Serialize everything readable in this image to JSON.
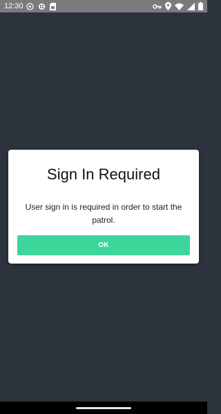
{
  "status_bar": {
    "time": "12:30",
    "left_icons": [
      "settings-notification-icon",
      "gear-icon",
      "sim-card-icon"
    ],
    "right_icons": [
      "vpn-key-icon",
      "location-icon",
      "wifi-icon",
      "signal-icon",
      "battery-icon"
    ]
  },
  "dialog": {
    "title": "Sign In Required",
    "message": "User sign in is required in order to start the patrol.",
    "ok_label": "OK"
  },
  "colors": {
    "background": "#2d333d",
    "status_bar": "#7b7b7b",
    "dialog": "#ffffff",
    "accent": "#3dd69b",
    "nav_bar": "#000000"
  }
}
